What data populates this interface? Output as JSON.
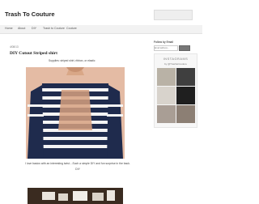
{
  "header": {
    "site_title": "Trash To Couture"
  },
  "nav": {
    "items": [
      {
        "label": "Home"
      },
      {
        "label": "About"
      },
      {
        "label": "DIY"
      },
      {
        "label": "Trash to Couture"
      },
      {
        "label": "Couture"
      }
    ]
  },
  "post": {
    "date": "4/08/13",
    "title": "DIY Cutout Striped shirt",
    "supplies": "Supplies: striped shirt, ribbon, or elastic",
    "caption": "I love basics with an interesting twist....Such a simple DIY and fun surprise in the back.",
    "caption_sub": "DIY"
  },
  "sidebar": {
    "follow_title": "Follow by Email",
    "follow_placeholder": "Email address...",
    "follow_button": "Submit",
    "instagram_title": "INSTAGRAMS",
    "instagram_handle": "by @TrashtoCouture"
  }
}
